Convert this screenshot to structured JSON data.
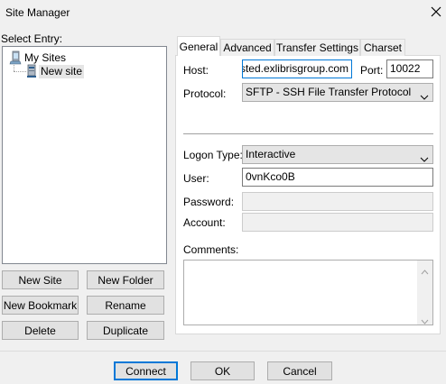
{
  "window": {
    "title": "Site Manager"
  },
  "select_entry_label": "Select Entry:",
  "tree": {
    "root": "My Sites",
    "child": "New site"
  },
  "left_buttons": {
    "new_site": "New Site",
    "new_folder": "New Folder",
    "new_bookmark": "New Bookmark",
    "rename": "Rename",
    "delete": "Delete",
    "duplicate": "Duplicate"
  },
  "tabs": [
    "General",
    "Advanced",
    "Transfer Settings",
    "Charset"
  ],
  "general": {
    "host_label": "Host:",
    "host_value": "hosted.exlibrisgroup.com",
    "port_label": "Port:",
    "port_value": "10022",
    "protocol_label": "Protocol:",
    "protocol_value": "SFTP - SSH File Transfer Protocol",
    "logon_type_label": "Logon Type:",
    "logon_type_value": "Interactive",
    "user_label": "User:",
    "user_value": "0vnKco0B",
    "password_label": "Password:",
    "account_label": "Account:",
    "comments_label": "Comments:"
  },
  "footer": {
    "connect": "Connect",
    "ok": "OK",
    "cancel": "Cancel"
  },
  "colors": {
    "focus": "#0078d7",
    "selection": "#e5e5e5"
  }
}
